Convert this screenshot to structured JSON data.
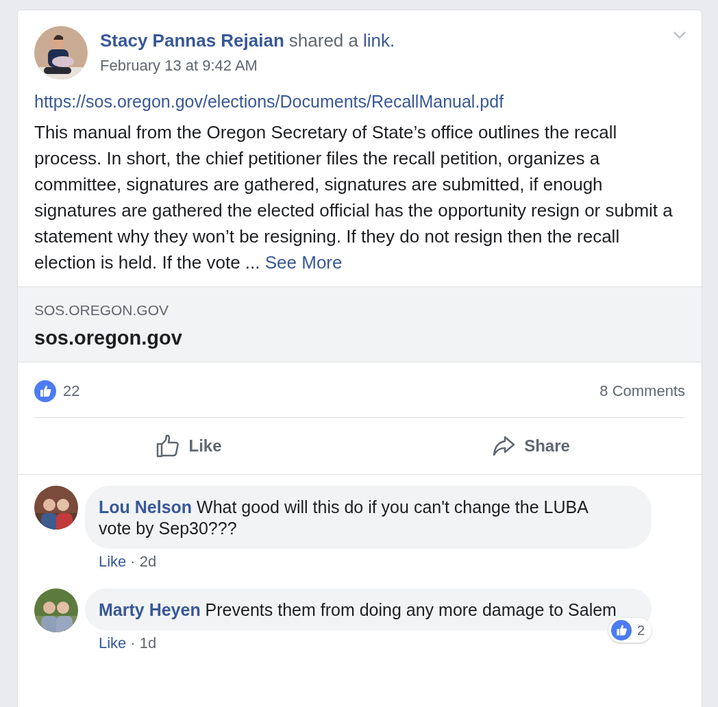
{
  "post": {
    "author": "Stacy Pannas Rejaian",
    "action": "shared a",
    "action_link": "link.",
    "timestamp": "February 13 at 9:42 AM",
    "url": "https://sos.oregon.gov/elections/Documents/RecallManual.pdf",
    "text": "This manual from the Oregon Secretary of State’s office outlines the recall process. In short, the chief petitioner files the recall petition, organizes a committee, signatures are gathered, signatures are submitted, if enough signatures are gathered the elected official has the opportunity resign or submit a statement why they won’t be resigning. If they do not resign then the recall election is held. If the vote ...",
    "see_more": "See More"
  },
  "link_preview": {
    "domain": "SOS.OREGON.GOV",
    "title": "sos.oregon.gov"
  },
  "reactions": {
    "count": "22",
    "comments": "8 Comments"
  },
  "actions": [
    {
      "label": "Like",
      "kind": "like"
    },
    {
      "label": "Share",
      "kind": "share"
    }
  ],
  "comments": [
    {
      "author": "Lou Nelson",
      "text": "What good will this do if you can't change the LUBA vote by Sep30???",
      "like": "Like",
      "separator": "·",
      "age": "2d"
    },
    {
      "author": "Marty Heyen",
      "text": "Prevents them from doing any more damage to Salem",
      "like": "Like",
      "separator": "·",
      "age": "1d",
      "reaction_count": "2"
    }
  ]
}
